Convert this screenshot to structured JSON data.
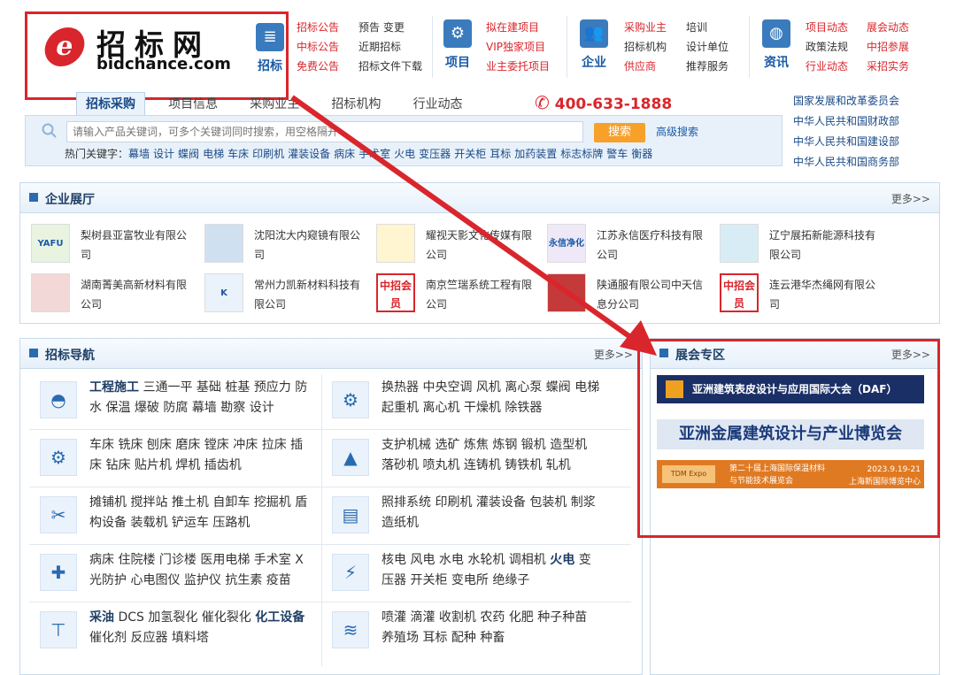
{
  "logo": {
    "mark": "e",
    "cn": "招标网",
    "en": "bidchance.com"
  },
  "nav_main": [
    {
      "label": "招标",
      "icon": "list-icon"
    },
    {
      "label": "项目",
      "icon": "gear-icon"
    },
    {
      "label": "企业",
      "icon": "people-icon"
    },
    {
      "label": "资讯",
      "icon": "globe-icon"
    }
  ],
  "links": {
    "col1": [
      "招标公告",
      "中标公告",
      "免费公告"
    ],
    "col2": [
      "预告 变更",
      "近期招标",
      "招标文件下载"
    ],
    "col3": [
      "拟在建项目",
      "VIP独家项目",
      "业主委托项目"
    ],
    "col4": [
      "采购业主",
      "招标机构",
      "供应商"
    ],
    "col5": [
      "培训",
      "设计单位",
      "推荐服务"
    ],
    "col6": [
      "项目动态",
      "政策法规",
      "行业动态"
    ],
    "col7": [
      "展会动态",
      "中招参展",
      "采招实务"
    ]
  },
  "tabs": [
    "招标采购",
    "项目信息",
    "采购业主",
    "招标机构",
    "行业动态"
  ],
  "hotline": "400-633-1888",
  "search": {
    "placeholder": "请输入产品关键词，可多个关键词同时搜索，用空格隔开",
    "button": "搜索",
    "advanced": "高级搜索",
    "hot_label": "热门关键字：",
    "hot_keys": [
      "幕墙",
      "设计",
      "蝶阀",
      "电梯",
      "车床",
      "印刷机",
      "灌装设备",
      "病床",
      "手术室",
      "火电",
      "变压器",
      "开关柜",
      "耳标",
      "加药装置",
      "标志标牌",
      "警车",
      "衡器"
    ]
  },
  "gov_links": [
    "国家发展和改革委员会",
    "中华人民共和国财政部",
    "中华人民共和国建设部",
    "中华人民共和国商务部"
  ],
  "firms": {
    "title": "企业展厅",
    "more": "更多>>",
    "items": [
      {
        "name": "梨树县亚富牧业有限公司",
        "thumb": "YAFU"
      },
      {
        "name": "沈阳沈大内窥镜有限公司",
        "thumb": ""
      },
      {
        "name": "耀视天影文化传媒有限公司",
        "thumb": ""
      },
      {
        "name": "江苏永信医疗科技有限公司",
        "thumb": "永信净化"
      },
      {
        "name": "辽宁展拓新能源科技有限公司",
        "thumb": ""
      },
      {
        "name": "湖南菁美高新材料有限公司",
        "thumb": ""
      },
      {
        "name": "常州力凯新材料科技有限公司",
        "thumb": "K"
      },
      {
        "name": "南京竺瑞系统工程有限公司",
        "thumb": "中招会员"
      },
      {
        "name": "陕通服有限公司中天信息分公司",
        "thumb": ""
      },
      {
        "name": "连云港华杰绳网有限公司",
        "thumb": "中招会员"
      }
    ]
  },
  "bid_nav": {
    "title": "招标导航",
    "more": "更多>>",
    "rows": [
      {
        "icon": "helmet-icon",
        "bold": "工程施工",
        "text": " 三通一平 基础 桩基 预应力 防水 保温 爆破 防腐 幕墙 勘察 设计"
      },
      {
        "icon": "cog-icon",
        "bold": "",
        "text": "换热器 中央空调 风机 离心泵 蝶阀 电梯 起重机 离心机 干燥机 除铁器"
      },
      {
        "icon": "gears-icon",
        "bold": "",
        "text": "车床 铣床 刨床 磨床 镗床 冲床 拉床 插床 钻床 贴片机 焊机 插齿机"
      },
      {
        "icon": "mountain-icon",
        "bold": "",
        "text": "支护机械 选矿 炼焦 炼钢 锻机 造型机 落砂机 喷丸机 连铸机 铸铁机 轧机"
      },
      {
        "icon": "tools-icon",
        "bold": "",
        "text": "摊铺机 搅拌站 推土机 自卸车 挖掘机 盾构设备 装载机 铲运车 压路机"
      },
      {
        "icon": "printer-icon",
        "bold": "",
        "text": "照排系统 印刷机 灌装设备 包装机 制浆 造纸机"
      },
      {
        "icon": "medkit-icon",
        "bold": "",
        "text": "病床 住院楼 门诊楼 医用电梯 手术室 X光防护 心电图仪 监护仪 抗生素 疫苗"
      },
      {
        "icon": "bolt-icon",
        "bold": "",
        "text": "核电 风电 水电 水轮机 调相机 ",
        "bold2": "火电",
        "text2": " 变压器 开关柜 变电所 绝缘子"
      },
      {
        "icon": "crane-icon",
        "bold": "采油",
        "text": " DCS 加氢裂化 催化裂化 ",
        "bold2": "化工设备",
        "text2": " 催化剂 反应器 填料塔"
      },
      {
        "icon": "water-icon",
        "bold": "",
        "text": "喷灌 滴灌 收割机 农药 化肥 种子种苗 养殖场 耳标 配种 种畜"
      }
    ]
  },
  "expo": {
    "title": "展会专区",
    "more": "更多>>",
    "banner1": "亚洲建筑表皮设计与应用国际大会（DAF）",
    "banner2": "亚洲金属建筑设计与产业博览会",
    "banner3_l1": "第二十届上海国际保温材料",
    "banner3_l2": "与节能技术展览会",
    "banner3_logo": "TDM Expo",
    "banner3_date": "2023.9.19-21",
    "banner3_venue": "上海新国际博览中心"
  }
}
